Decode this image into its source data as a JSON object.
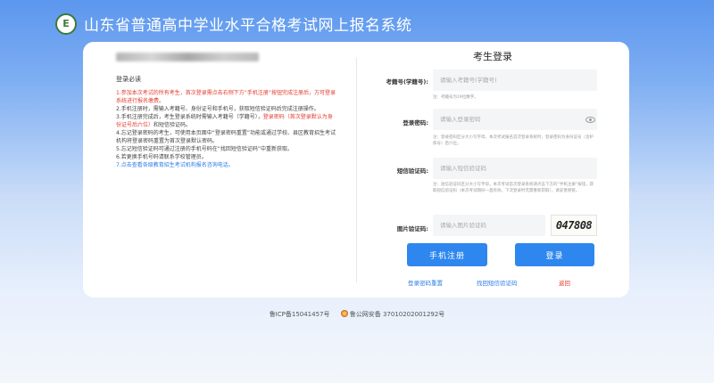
{
  "header": {
    "logo_text": "E",
    "title": "山东省普通高中学业水平合格考试网上报名系统"
  },
  "notice": {
    "heading": "登录必读",
    "items": [
      {
        "text": "1.参加本次考试的所有考生，首次登录需点击右侧下方“手机注册”按钮完成注册后，方可登录系统进行报名缴费。",
        "style": "red"
      },
      {
        "text": "2.手机注册时，需输入考籍号、身份证号和手机号，获取短信验证码后完成注册操作。",
        "style": "normal"
      },
      {
        "text_a": "3.手机注册完成后，考生登录系统时需输入考籍号（学籍号），",
        "text_b": "登录密码（首次登录默认为身份证号后六位）",
        "text_c": "和短信验证码。"
      },
      {
        "text": "4.忘记登录密码的考生，可使用本页面中“登录密码重置”功能或通过学校、县区教育招生考试机构将登录密码重置为首次登录默认密码。",
        "style": "normal"
      },
      {
        "text": "5.忘记短信验证码可通过注册的手机号码在“找回短信验证码”中重新获取。",
        "style": "normal"
      },
      {
        "text": "6.若更换手机号码请联系学校管理员。",
        "style": "normal"
      },
      {
        "text": "7.点击查看各级教育招生考试机构报名咨询电话。",
        "style": "blue"
      }
    ]
  },
  "login": {
    "title": "考生登录",
    "student_id": {
      "label": "考籍号(学籍号):",
      "placeholder": "请输入考籍号(学籍号)",
      "note": "注：考籍号为19位数字。"
    },
    "password": {
      "label": "登录密码:",
      "placeholder": "请输入登录密码",
      "note": "注：登录密码区分大小写字母，本次考试报名首次登录系统时，登录密码为身份证号（含护照号）后六位。"
    },
    "sms": {
      "label": "短信验证码:",
      "placeholder": "请输入短信验证码",
      "note": "注：短信验证码区分大小写字母，本次考试首次登录系统请点击下方的“手机注册”按钮，获取短信验证码（本次考试期间一直有效，下次登录时无需重新获取），请妥善保管。"
    },
    "captcha": {
      "label": "图片验证码:",
      "placeholder": "请输入图片验证码",
      "image_text": "047808"
    },
    "register_button": "手机注册",
    "login_button": "登录",
    "link_reset": "登录密码重置",
    "link_sms": "找回短信验证码",
    "link_back": "返回"
  },
  "footer": {
    "icp": "鲁ICP备15041457号",
    "police": "鲁公网安备 37010202001292号"
  }
}
